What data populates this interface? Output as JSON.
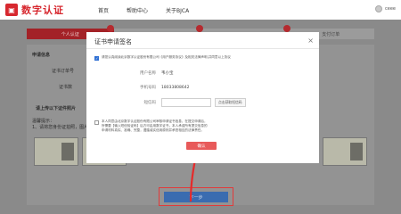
{
  "brand": {
    "logo_glyph": "▣",
    "name": "数字认证",
    "accent": "#d7282f"
  },
  "nav": {
    "home": "首页",
    "help": "帮助中心",
    "about": "关于BJCA"
  },
  "user": {
    "name": "ceee"
  },
  "steps": [
    {
      "label": "个人认证"
    },
    {
      "label": ""
    },
    {
      "label": ""
    },
    {
      "label": "支付订单"
    }
  ],
  "background": {
    "section_apply": "申请信息",
    "field_cert_type": "证书订单号",
    "field_cert": "证书数",
    "section_upload": "请上传以下证件照片",
    "upload_hint_title": "温馨提示：",
    "upload_hint": "1、请将您身份证拍照，图片有效期内",
    "next_button": "下一步"
  },
  "modal": {
    "title": "证书申请签名",
    "close": "×",
    "agreement_1": "请您认真阅读北京数字认证股份有限公司《用户服务协议》及相关法律声明,并同意以上协议",
    "user_name_label": "用户名称",
    "user_name_value": "韦小宝",
    "phone_label": "手机号码",
    "phone_value": "18033808642",
    "code_label": "短信码",
    "code_placeholder": "",
    "code_button": "点击获取短信码",
    "agreement_2_line1": "本人同意由北京数字认证股份有限公司审核申请证书信息，在提交申请后，",
    "agreement_2_line2": "所需要【输入短信验证码】后方可启用数字证书，本人承诺所有提交信息的",
    "agreement_2_line3": "申请材料真实、准确、完整，遵循诚实信用原则并承担相应的法律责任。",
    "confirm_button": "确认"
  }
}
